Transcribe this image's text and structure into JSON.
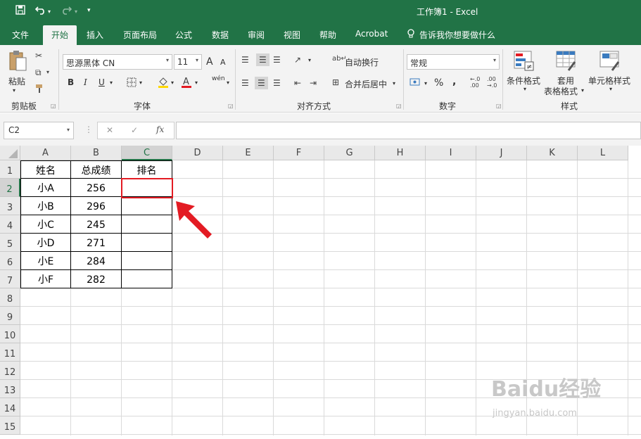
{
  "title_bar": {
    "title": "工作簿1  -  Excel",
    "save_icon": "save-icon",
    "undo_icon": "undo-icon",
    "redo_icon": "redo-icon"
  },
  "tabs": [
    "文件",
    "开始",
    "插入",
    "页面布局",
    "公式",
    "数据",
    "审阅",
    "视图",
    "帮助",
    "Acrobat",
    "告诉我你想要做什么"
  ],
  "ribbon": {
    "clipboard": {
      "paste": "粘贴",
      "label": "剪贴板"
    },
    "font": {
      "name": "思源黑体 CN",
      "size": "11",
      "bold": "B",
      "italic": "I",
      "underline": "U",
      "grow": "A",
      "shrink": "A",
      "phonetic": "wén",
      "label": "字体"
    },
    "alignment": {
      "wrap": "自动换行",
      "merge": "合并后居中",
      "label": "对齐方式"
    },
    "number": {
      "format": "常规",
      "percent": "%",
      "comma": ",",
      "label": "数字"
    },
    "styles": {
      "conditional": "条件格式",
      "table1": "套用",
      "table2": "表格格式",
      "cell": "单元格样式",
      "label": "样式"
    }
  },
  "formula_bar": {
    "name_box": "C2",
    "cancel": "✕",
    "enter": "✓",
    "fx": "fx",
    "value": ""
  },
  "sheet": {
    "columns": [
      "A",
      "B",
      "C",
      "D",
      "E",
      "F",
      "G",
      "H",
      "I",
      "J",
      "K",
      "L"
    ],
    "rows": [
      "1",
      "2",
      "3",
      "4",
      "5",
      "6",
      "7",
      "8",
      "9",
      "10",
      "11",
      "12",
      "13",
      "14",
      "15"
    ],
    "cells": [
      [
        "姓名",
        "总成绩",
        "排名"
      ],
      [
        "小A",
        "256",
        ""
      ],
      [
        "小B",
        "296",
        ""
      ],
      [
        "小C",
        "245",
        ""
      ],
      [
        "小D",
        "271",
        ""
      ],
      [
        "小E",
        "284",
        ""
      ],
      [
        "小F",
        "282",
        ""
      ]
    ]
  },
  "watermark": {
    "brand": "Baidu经验",
    "url": "jingyan.baidu.com"
  },
  "colors": {
    "accent": "#217346",
    "highlight": "#e31b23"
  }
}
